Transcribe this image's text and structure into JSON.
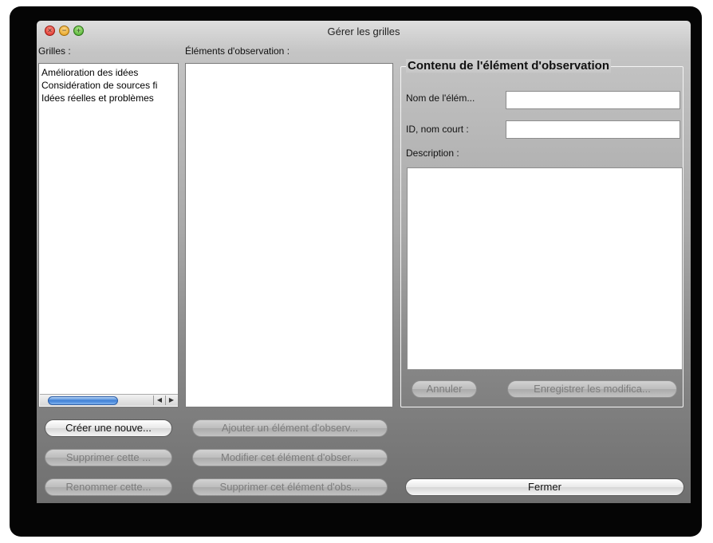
{
  "window": {
    "title": "Gérer les grilles"
  },
  "grilles": {
    "label": "Grilles :",
    "items": [
      "Amélioration des idées",
      "Considération de sources fi",
      "Idées réelles et problèmes"
    ]
  },
  "elements": {
    "label": "Éléments d'observation :"
  },
  "content": {
    "group_title": "Contenu de l'élément d'observation",
    "name_label": "Nom de l'élém...",
    "name_value": "",
    "id_label": "ID, nom court :",
    "id_value": "",
    "description_label": "Description :",
    "description_value": "",
    "cancel_label": "Annuler",
    "save_label": "Enregistrer les modifica..."
  },
  "grille_buttons": {
    "create": "Créer une nouve...",
    "delete": "Supprimer cette ...",
    "rename": "Renommer cette..."
  },
  "element_buttons": {
    "add": "Ajouter un élément d'observ...",
    "modify": "Modifier cet élément d'obser...",
    "delete": "Supprimer cet élément d'obs..."
  },
  "close_label": "Fermer"
}
